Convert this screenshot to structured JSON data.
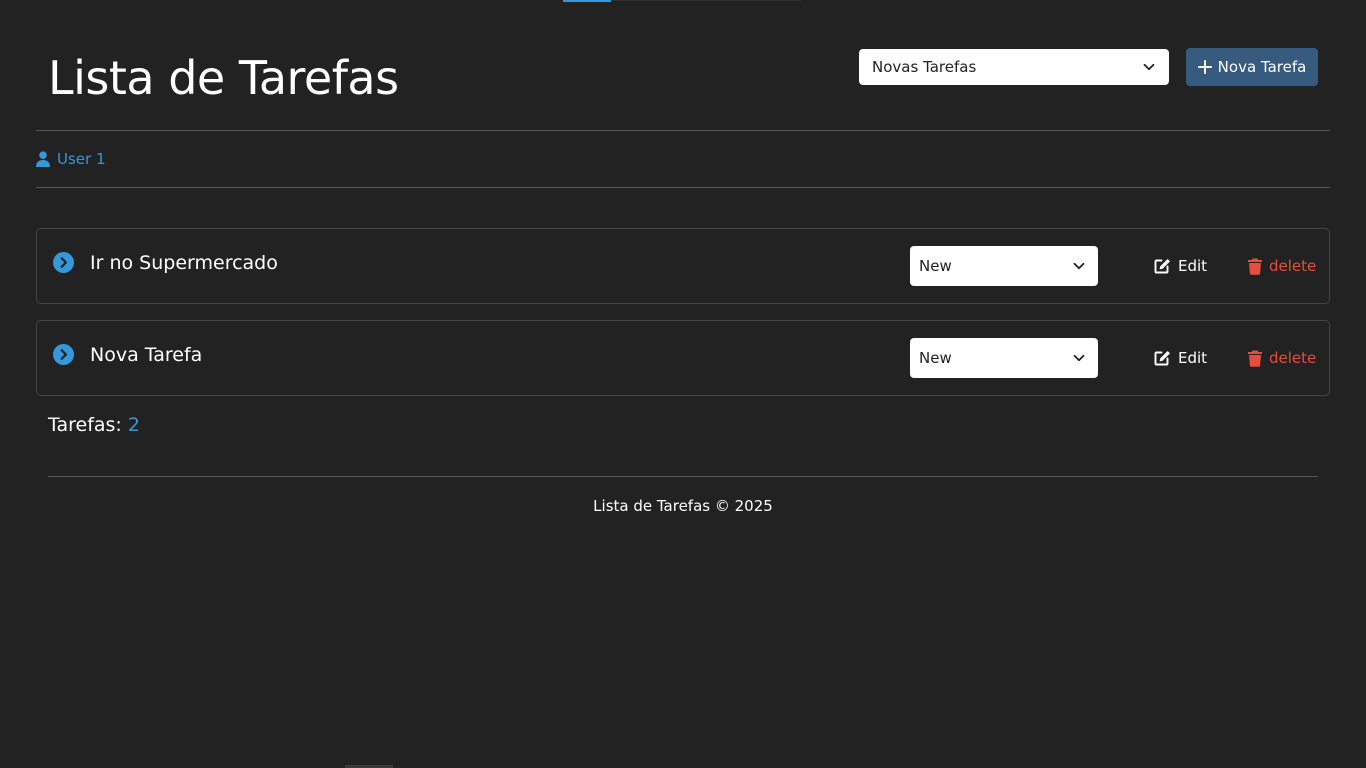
{
  "header": {
    "title": "Lista de Tarefas",
    "filter": {
      "selected": "Novas Tarefas",
      "icon": "chevron-down-icon"
    },
    "new_task_button": {
      "label": "Nova Tarefa",
      "icon": "plus-icon"
    }
  },
  "user": {
    "name": "User 1",
    "icon": "user-icon"
  },
  "tasks": [
    {
      "title": "Ir no Supermercado",
      "status": "New",
      "edit_label": "Edit",
      "delete_label": "delete"
    },
    {
      "title": "Nova Tarefa",
      "status": "New",
      "edit_label": "Edit",
      "delete_label": "delete"
    }
  ],
  "summary": {
    "label": "Tarefas:",
    "count": "2"
  },
  "footer": {
    "text": "Lista de Tarefas © 2025"
  },
  "colors": {
    "background": "#222222",
    "accent": "#3498db",
    "primary_button": "#375a7f",
    "danger": "#e74c3c",
    "border": "#444444"
  }
}
